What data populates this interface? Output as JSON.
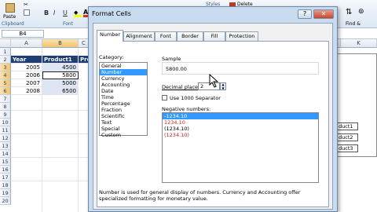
{
  "ribbon": {
    "paste_label": "Paste",
    "clipboard_label": "Clipboard",
    "font_label": "Font",
    "bold": "B",
    "italic": "I",
    "underline": "U",
    "styles_label": "Styles",
    "delete_label": "Delete",
    "find_label": "Find &"
  },
  "formula": {
    "name_box": "B4"
  },
  "sheet": {
    "columns": [
      "A",
      "B",
      "C",
      "K"
    ],
    "rows": [
      "1",
      "2",
      "3",
      "4",
      "5",
      "6",
      "7",
      "8",
      "9",
      "10",
      "11",
      "12",
      "13",
      "14",
      "15",
      "16",
      "17",
      "18",
      "19",
      "20"
    ],
    "headers": [
      "Year",
      "Product1",
      "Pro"
    ],
    "data": [
      {
        "year": "2005",
        "p1": "4500"
      },
      {
        "year": "2006",
        "p1": "5800"
      },
      {
        "year": "2007",
        "p1": "5000"
      },
      {
        "year": "2008",
        "p1": "6500"
      }
    ],
    "chart_labels": [
      "duct1",
      "duct2",
      "duct3"
    ]
  },
  "dialog": {
    "title": "Format Cells",
    "help": "?",
    "close": "✕",
    "tabs": [
      "Number",
      "Alignment",
      "Font",
      "Border",
      "Fill",
      "Protection"
    ],
    "category_label": "Category:",
    "categories": [
      "General",
      "Number",
      "Currency",
      "Accounting",
      "Date",
      "Time",
      "Percentage",
      "Fraction",
      "Scientific",
      "Text",
      "Special",
      "Custom"
    ],
    "selected_category": "Number",
    "sample_label": "Sample",
    "sample_value": "5800.00",
    "decimal_label": "Decimal places:",
    "decimal_value": "2",
    "separator_label": "Use 1000 Separator",
    "negative_label": "Negative numbers:",
    "negatives": [
      {
        "text": "-1234.10",
        "style": "selected"
      },
      {
        "text": "1234.10",
        "style": "red"
      },
      {
        "text": "(1234.10)",
        "style": "plain"
      },
      {
        "text": "(1234.10)",
        "style": "red"
      }
    ],
    "description": "Number is used for general display of numbers.  Currency and Accounting offer specialized formatting for monetary value."
  }
}
